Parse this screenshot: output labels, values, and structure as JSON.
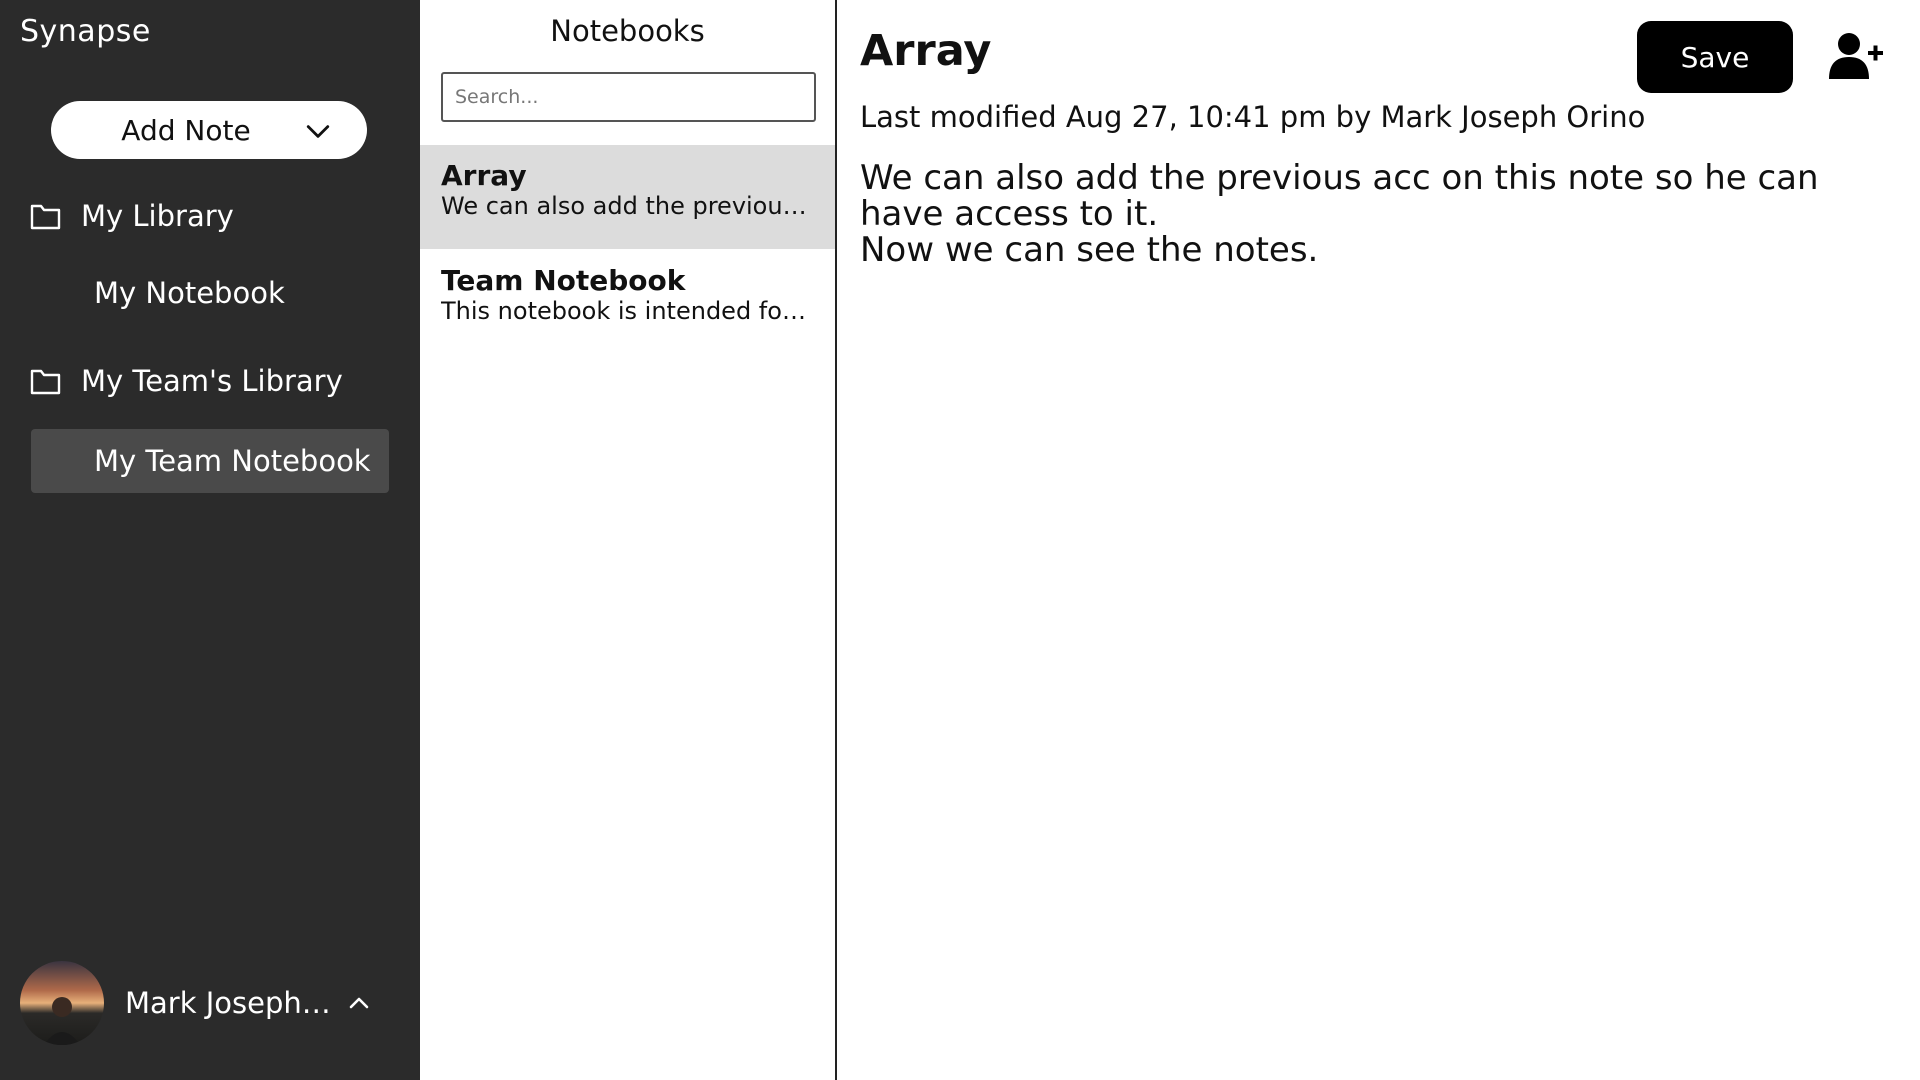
{
  "app": {
    "name": "Synapse"
  },
  "sidebar": {
    "add_note_label": "Add Note",
    "libraries": [
      {
        "label": "My Library",
        "notebooks": [
          "My Notebook"
        ]
      },
      {
        "label": "My Team's Library",
        "notebooks": [
          "My Team Notebook"
        ]
      }
    ],
    "selected_notebook": "My Team Notebook",
    "user": {
      "name": "Mark Joseph Orino"
    }
  },
  "list": {
    "title": "Notebooks",
    "search_placeholder": "Search...",
    "notes": [
      {
        "title": "Array",
        "preview": "We can also add the previous acc on this note so he can have access to it."
      },
      {
        "title": "Team Notebook",
        "preview": "This notebook is intended for the team."
      }
    ]
  },
  "editor": {
    "title": "Array",
    "save_label": "Save",
    "meta": "Last modified Aug 27, 10:41 pm by Mark Joseph Orino",
    "body_lines": [
      "We can also add the previous acc on this note so he can have access to it.",
      "Now we can see the notes."
    ]
  },
  "colors": {
    "sidebar_bg": "#2b2b2b",
    "sidebar_selected": "#4a4a4a",
    "list_selected": "#dcdcdc",
    "primary_button": "#000000"
  },
  "icons": [
    "chevron-down-icon",
    "folder-icon",
    "chevron-up-icon",
    "add-user-icon"
  ]
}
